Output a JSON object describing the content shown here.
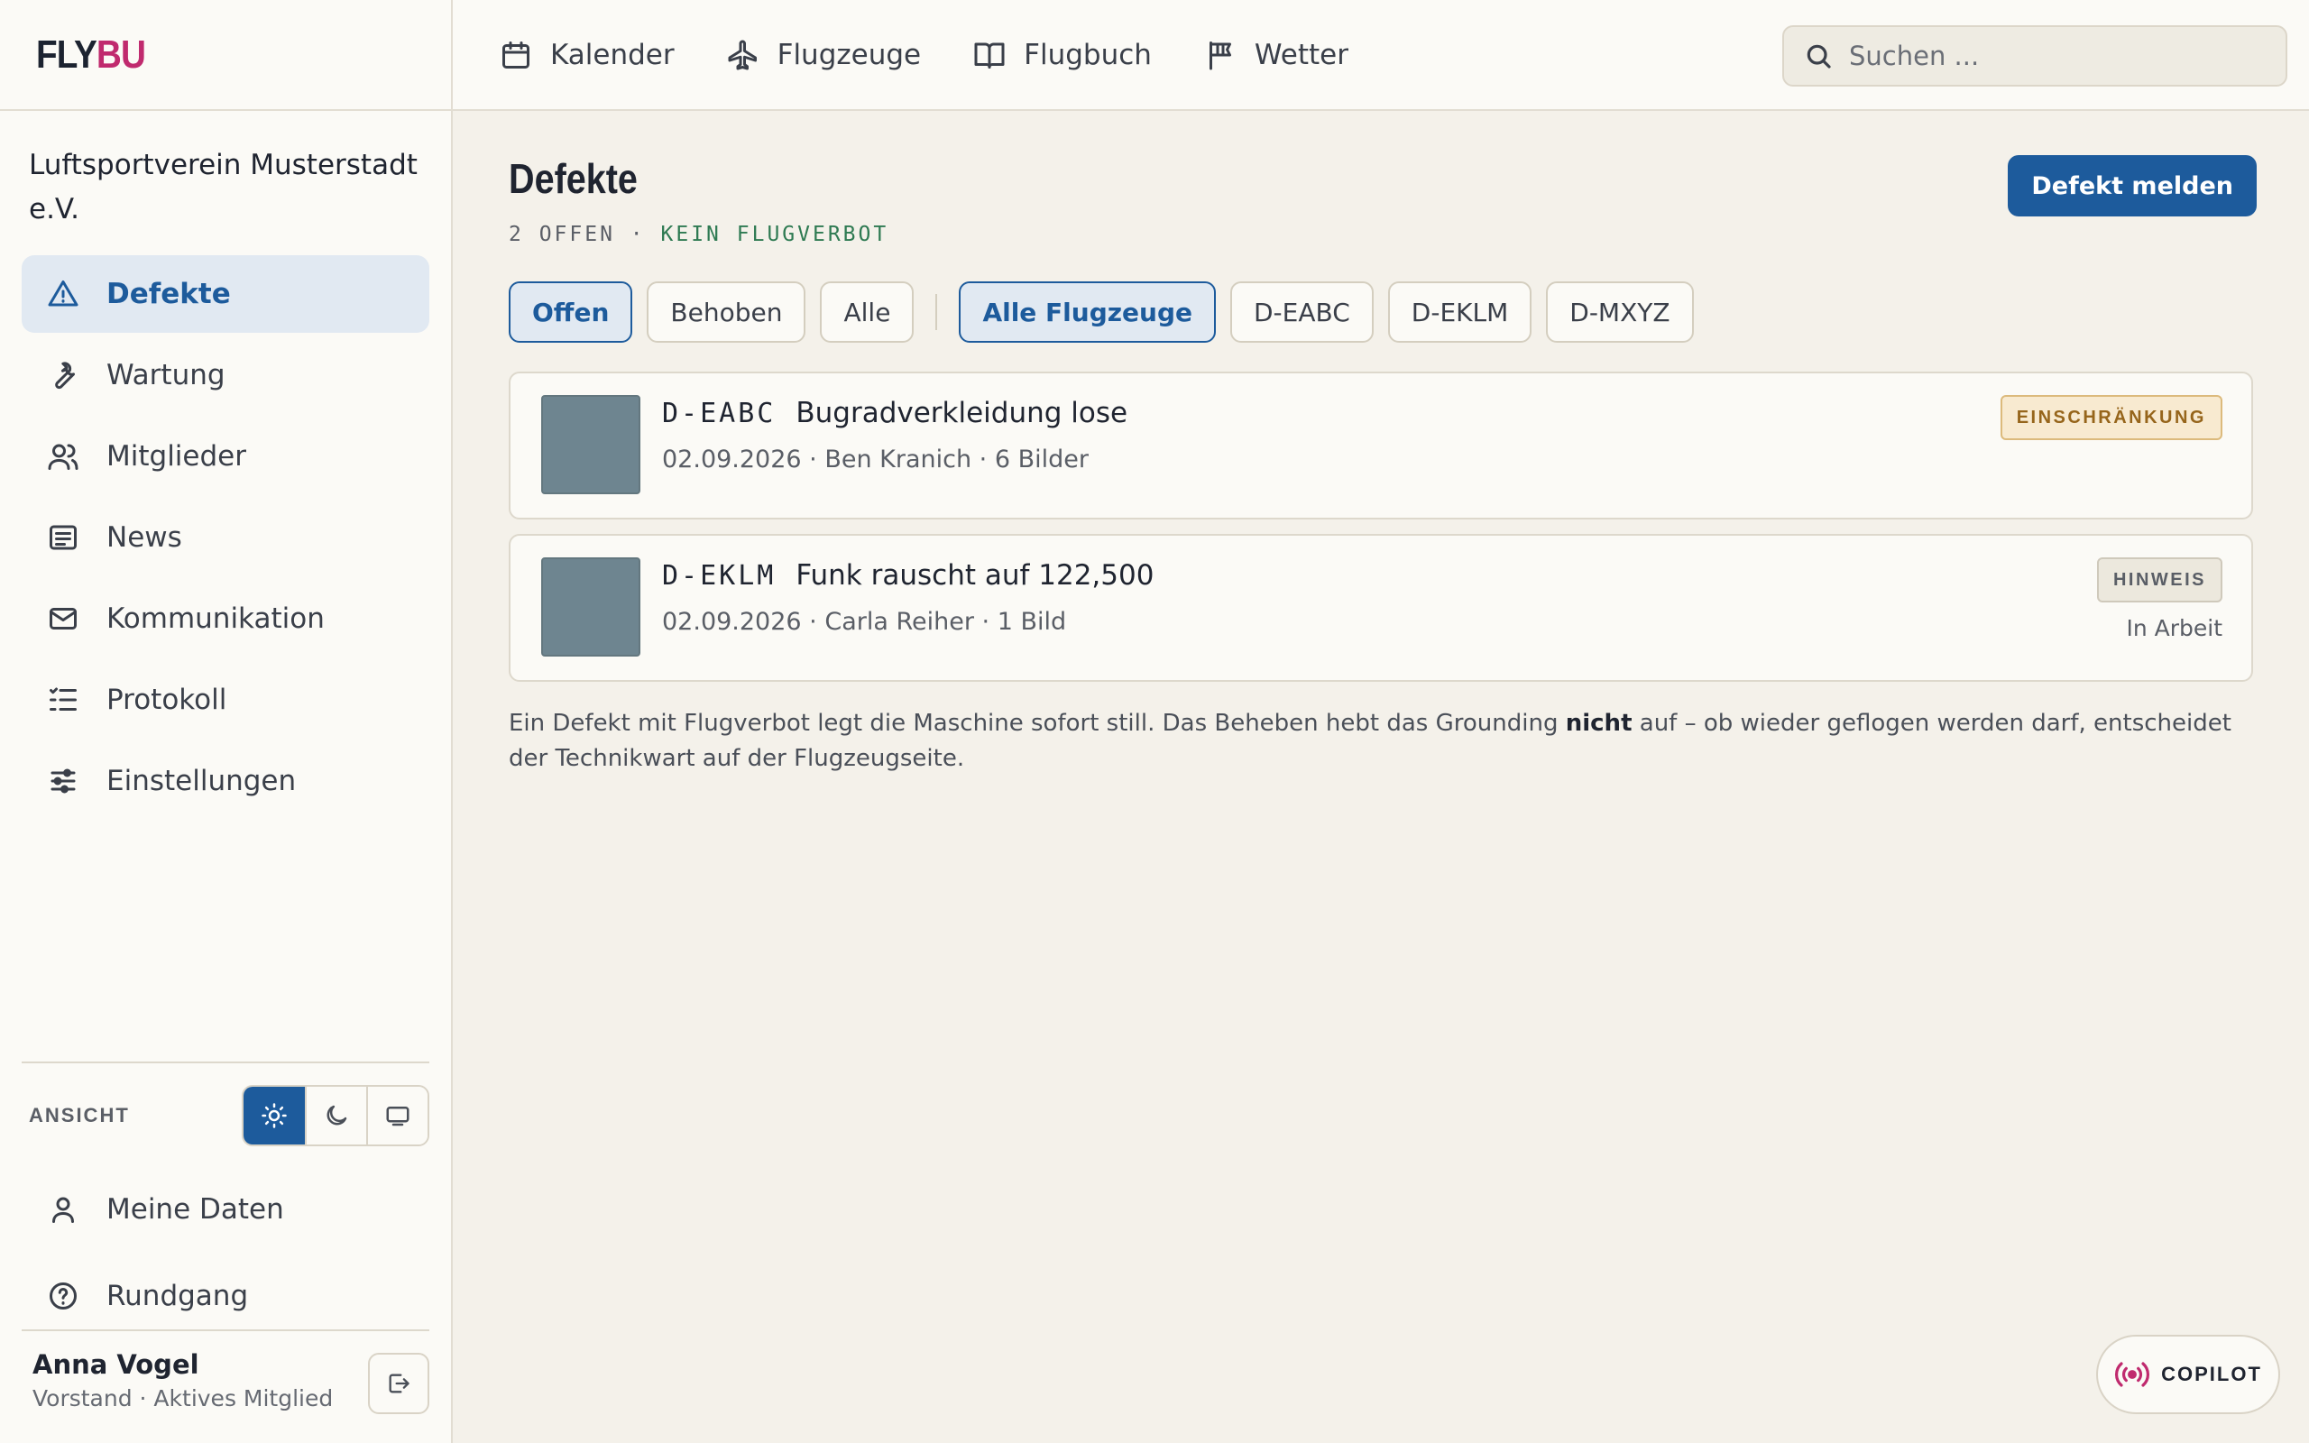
{
  "brand": {
    "part1": "FLY",
    "part2": "BU"
  },
  "sidebar": {
    "org_name": "Luftsportverein Musterstadt e.V.",
    "items": [
      {
        "label": "Defekte",
        "icon": "warning-icon",
        "active": true
      },
      {
        "label": "Wartung",
        "icon": "wrench-icon"
      },
      {
        "label": "Mitglieder",
        "icon": "users-icon"
      },
      {
        "label": "News",
        "icon": "news-icon"
      },
      {
        "label": "Kommunikation",
        "icon": "mail-icon"
      },
      {
        "label": "Protokoll",
        "icon": "list-icon"
      },
      {
        "label": "Einstellungen",
        "icon": "sliders-icon"
      }
    ],
    "ansicht_label": "ANSICHT",
    "theme_active": "light",
    "meine_daten": "Meine Daten",
    "rundgang": "Rundgang",
    "user": {
      "name": "Anna Vogel",
      "role": "Vorstand · Aktives Mitglied"
    }
  },
  "topnav": {
    "links": [
      "Kalender",
      "Flugzeuge",
      "Flugbuch",
      "Wetter"
    ],
    "search_placeholder": "Suchen ..."
  },
  "main": {
    "title": "Defekte",
    "sub_count": "2 OFFEN",
    "sub_dot": "·",
    "sub_status": "KEIN FLUGVERBOT",
    "report_button": "Defekt melden",
    "status_filters": [
      "Offen",
      "Behoben",
      "Alle"
    ],
    "aircraft_filters": [
      "Alle Flugzeuge",
      "D-EABC",
      "D-EKLM",
      "D-MXYZ"
    ],
    "defects": [
      {
        "reg": "D-EABC",
        "title": "Bugradverkleidung lose",
        "meta": "02.09.2026 · Ben Kranich · 6 Bilder",
        "badge": "EINSCHRÄNKUNG",
        "status": ""
      },
      {
        "reg": "D-EKLM",
        "title": "Funk rauscht auf 122,500",
        "meta": "02.09.2026 · Carla Reiher · 1 Bild",
        "badge": "HINWEIS",
        "status": "In Arbeit"
      }
    ],
    "note_part1": "Ein Defekt mit Flugverbot legt die Maschine sofort still. Das Beheben hebt das Grounding ",
    "note_bold": "nicht",
    "note_part2": " auf – ob wieder geflogen werden darf, entscheidet der Technikwart auf der Flugzeugseite."
  },
  "copilot_label": "COPILOT",
  "colors": {
    "accent": "#1d5b9c",
    "brand": "#c02a6e",
    "ok": "#2e7a52",
    "warn": "#96651b"
  }
}
